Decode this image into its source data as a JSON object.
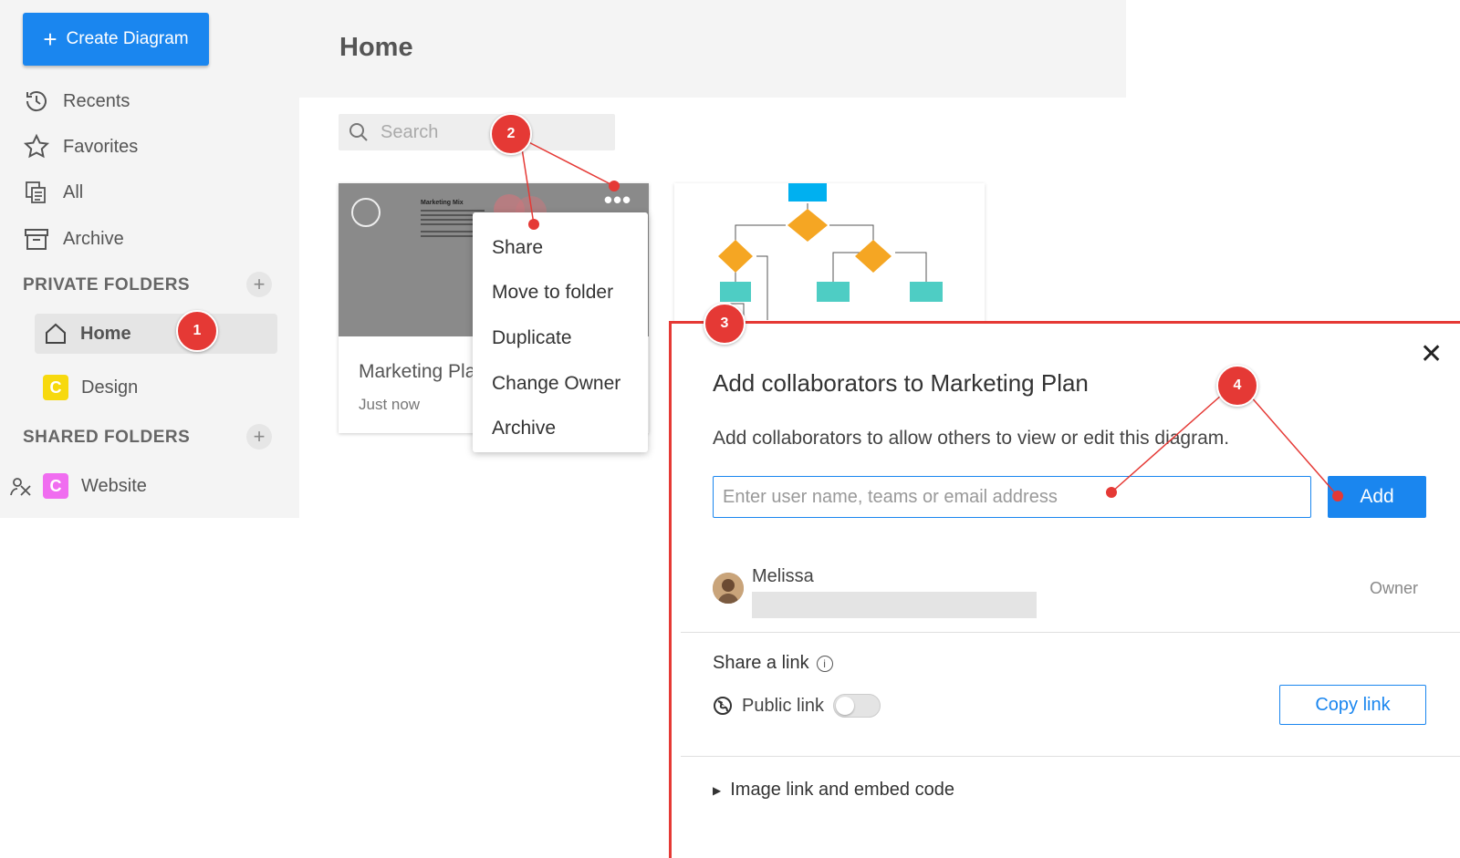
{
  "sidebar": {
    "create_label": "Create Diagram",
    "nav": [
      "Recents",
      "Favorites",
      "All",
      "Archive"
    ],
    "private_title": "PRIVATE FOLDERS",
    "shared_title": "SHARED FOLDERS",
    "private_folders": [
      {
        "label": "Home"
      },
      {
        "label": "Design",
        "badge": "C",
        "color": "#f7d90e"
      }
    ],
    "shared_folders": [
      {
        "label": "Website",
        "badge": "C",
        "color": "#f06df0"
      }
    ]
  },
  "header": {
    "title": "Home"
  },
  "search": {
    "placeholder": "Search"
  },
  "cards": [
    {
      "title": "Marketing Plan",
      "subtitle": "Just now",
      "thumb_title": "Marketing Mix"
    }
  ],
  "context_menu": [
    "Share",
    "Move to folder",
    "Duplicate",
    "Change Owner",
    "Archive"
  ],
  "dialog": {
    "title": "Add collaborators to Marketing Plan",
    "description": "Add collaborators to allow others to view or edit this diagram.",
    "input_placeholder": "Enter user name, teams or email address",
    "add_label": "Add",
    "user_name": "Melissa",
    "user_role": "Owner",
    "share_title": "Share a link",
    "public_link_label": "Public link",
    "public_link_on": false,
    "copy_label": "Copy link",
    "embed_label": "Image link and embed code"
  },
  "callouts": [
    "1",
    "2",
    "3",
    "4"
  ],
  "colors": {
    "accent": "#1a86ef",
    "callout": "#e53935",
    "flow_blue": "#00b0f0",
    "flow_orange": "#f5a623",
    "flow_teal": "#4ecdc4"
  }
}
